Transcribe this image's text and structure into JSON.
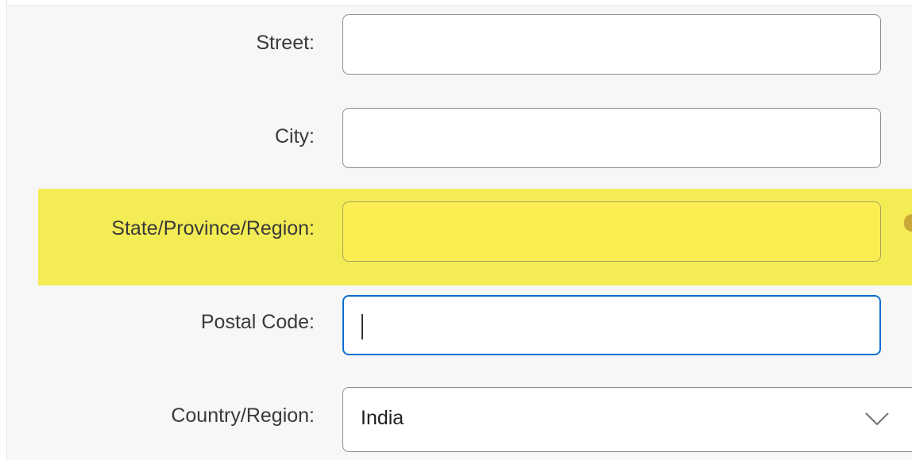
{
  "form": {
    "fields": [
      {
        "label": "Street:",
        "value": ""
      },
      {
        "label": "City:",
        "value": ""
      },
      {
        "label": "State/Province/Region:",
        "value": ""
      },
      {
        "label": "Postal Code:",
        "value": ""
      },
      {
        "label": "Country/Region:",
        "value": "India"
      }
    ]
  },
  "colors": {
    "highlight": "#f4ec55",
    "focus_border": "#0a6ed1"
  },
  "icons": {
    "dropdown": "chevron-down-icon"
  }
}
